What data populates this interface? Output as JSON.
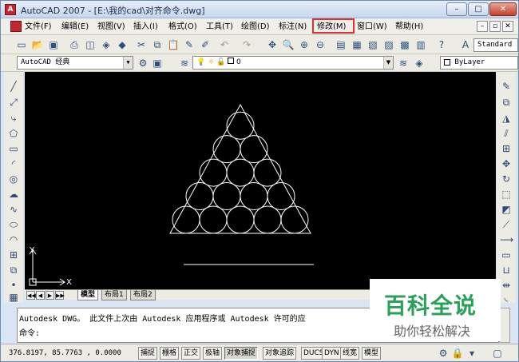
{
  "window": {
    "title": "AutoCAD 2007 - [E:\\我的cad\\对齐命令.dwg]",
    "app_icon_letter": "A",
    "minimize_glyph": "–",
    "maximize_glyph": "□",
    "close_glyph": "✕"
  },
  "menubar": {
    "items": [
      {
        "label": "文件(F)"
      },
      {
        "label": "编辑(E)"
      },
      {
        "label": "视图(V)"
      },
      {
        "label": "插入(I)"
      },
      {
        "label": "格式(O)"
      },
      {
        "label": "工具(T)"
      },
      {
        "label": "绘图(D)"
      },
      {
        "label": "标注(N)"
      },
      {
        "label": "修改(M)"
      },
      {
        "label": "窗口(W)"
      },
      {
        "label": "帮助(H)"
      }
    ],
    "mdi_buttons": [
      "–",
      "▫",
      "✕"
    ]
  },
  "toolbar1": {
    "text_style": "Standard"
  },
  "toolbar2": {
    "workspace": "AutoCAD 经典",
    "layer": "0",
    "color": "ByLayer"
  },
  "canvas": {
    "background": "#000000",
    "line_color": "#ffffff",
    "ucs_x": "X",
    "ucs_y": "Y"
  },
  "layout_tabs": {
    "nav": [
      "◀◀",
      "◀",
      "▶",
      "▶▶"
    ],
    "tabs": [
      "模型",
      "布局1",
      "布局2"
    ],
    "active": "模型"
  },
  "command": {
    "line1": "Autodesk DWG。  此文件上次由 Autodesk 应用程序或 Autodesk 许可的应",
    "line2": "命令:"
  },
  "watermark": {
    "title": "百科全说",
    "subtitle": "助你轻松解决"
  },
  "statusbar": {
    "coords": "376.8197, 85.7763 , 0.0000",
    "buttons": [
      {
        "label": "捕捉",
        "pressed": false
      },
      {
        "label": "栅格",
        "pressed": false
      },
      {
        "label": "正交",
        "pressed": false
      },
      {
        "label": "极轴",
        "pressed": false
      },
      {
        "label": "对象捕捉",
        "pressed": true
      },
      {
        "label": "对象追踪",
        "pressed": false
      },
      {
        "label": "DUCS",
        "pressed": false
      },
      {
        "label": "DYN",
        "pressed": false
      },
      {
        "label": "线宽",
        "pressed": false
      },
      {
        "label": "模型",
        "pressed": false
      }
    ]
  },
  "annotation": {
    "highlight_color": "#e03030"
  }
}
